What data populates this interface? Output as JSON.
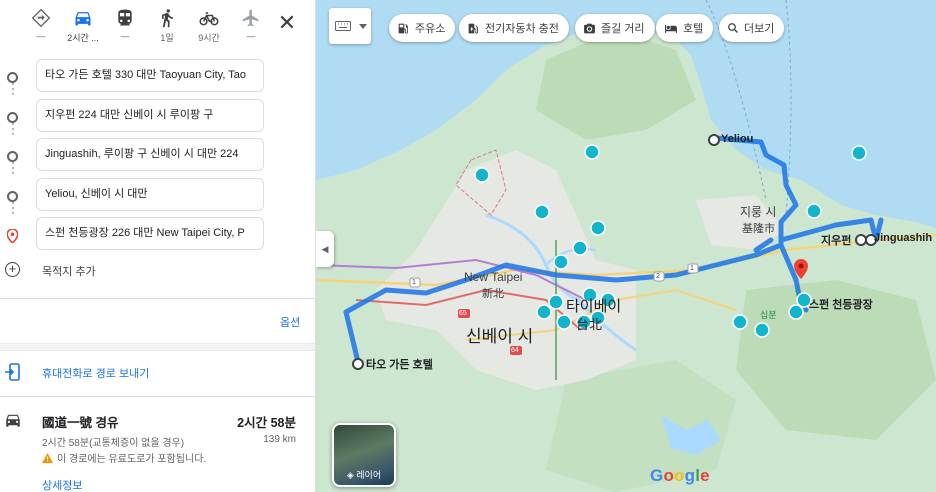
{
  "modes": [
    {
      "id": "best",
      "label": "—",
      "active": false
    },
    {
      "id": "drive",
      "label": "2시간 ...",
      "active": true
    },
    {
      "id": "transit",
      "label": "—",
      "active": false
    },
    {
      "id": "walk",
      "label": "1일",
      "active": false
    },
    {
      "id": "bike",
      "label": "9시간",
      "active": false
    },
    {
      "id": "flight",
      "label": "—",
      "active": false
    }
  ],
  "close_symbol": "✕",
  "stops": [
    {
      "value": "타오 가든 호텔 330 대만 Taoyuan City, Tao",
      "kind": "start"
    },
    {
      "value": "지우펀 224 대만 신베이 시 루이팡 구",
      "kind": "waypoint"
    },
    {
      "value": "Jinguashih, 루이팡 구 신베이 시 대만 224",
      "kind": "waypoint"
    },
    {
      "value": "Yeliou, 신베이 시 대만",
      "kind": "waypoint"
    },
    {
      "value": "스펀 천등광장 226 대만 New Taipei City, P",
      "kind": "destination"
    }
  ],
  "add_destination": "목적지 추가",
  "options_label": "옵션",
  "send_to_phone": "휴대전화로 경로 보내기",
  "route": {
    "name": "國道一號 경유",
    "duration": "2시간 58분",
    "summary": "2시간 58분(교통체증이 없을 경우)",
    "distance": "139 km",
    "warning": "이 경로에는 유료도로가 포함됩니다.",
    "details_label": "상세정보"
  },
  "map": {
    "chips": [
      {
        "icon": "gas-icon",
        "label": "주유소"
      },
      {
        "icon": "ev-charger-icon",
        "label": "전기자동차 충전"
      },
      {
        "icon": "camera-icon",
        "label": "즐길 거리"
      },
      {
        "icon": "bed-icon",
        "label": "호텔"
      },
      {
        "icon": "search-icon",
        "label": "더보기"
      }
    ],
    "layers_label": "레이어",
    "labels": {
      "new_taipei": "New Taipei",
      "new_taipei_cjk": "新北",
      "taipei": "타이베이",
      "taipei_cjk": "台北",
      "xinbei_si": "신베이 시",
      "keelung": "지룽 시",
      "keelung_cjk": "基隆市",
      "yeliou": "Yeliou",
      "jiufen": "지우펀",
      "jinguashih": "Jinguashih",
      "shifen": "스펀 천등광장",
      "tao_garden": "타오 가든 호텔",
      "shifen_small": "십분",
      "road_1": "1",
      "road_65": "65",
      "road_64": "64",
      "road_2": "2"
    },
    "attribution": "Google",
    "colors": {
      "route": "#4a90e2",
      "water": "#aadaff",
      "land": "#cfe8cf",
      "urban": "#e8eae6",
      "poi": "#12b5cb",
      "pin": "#ea4335"
    }
  }
}
